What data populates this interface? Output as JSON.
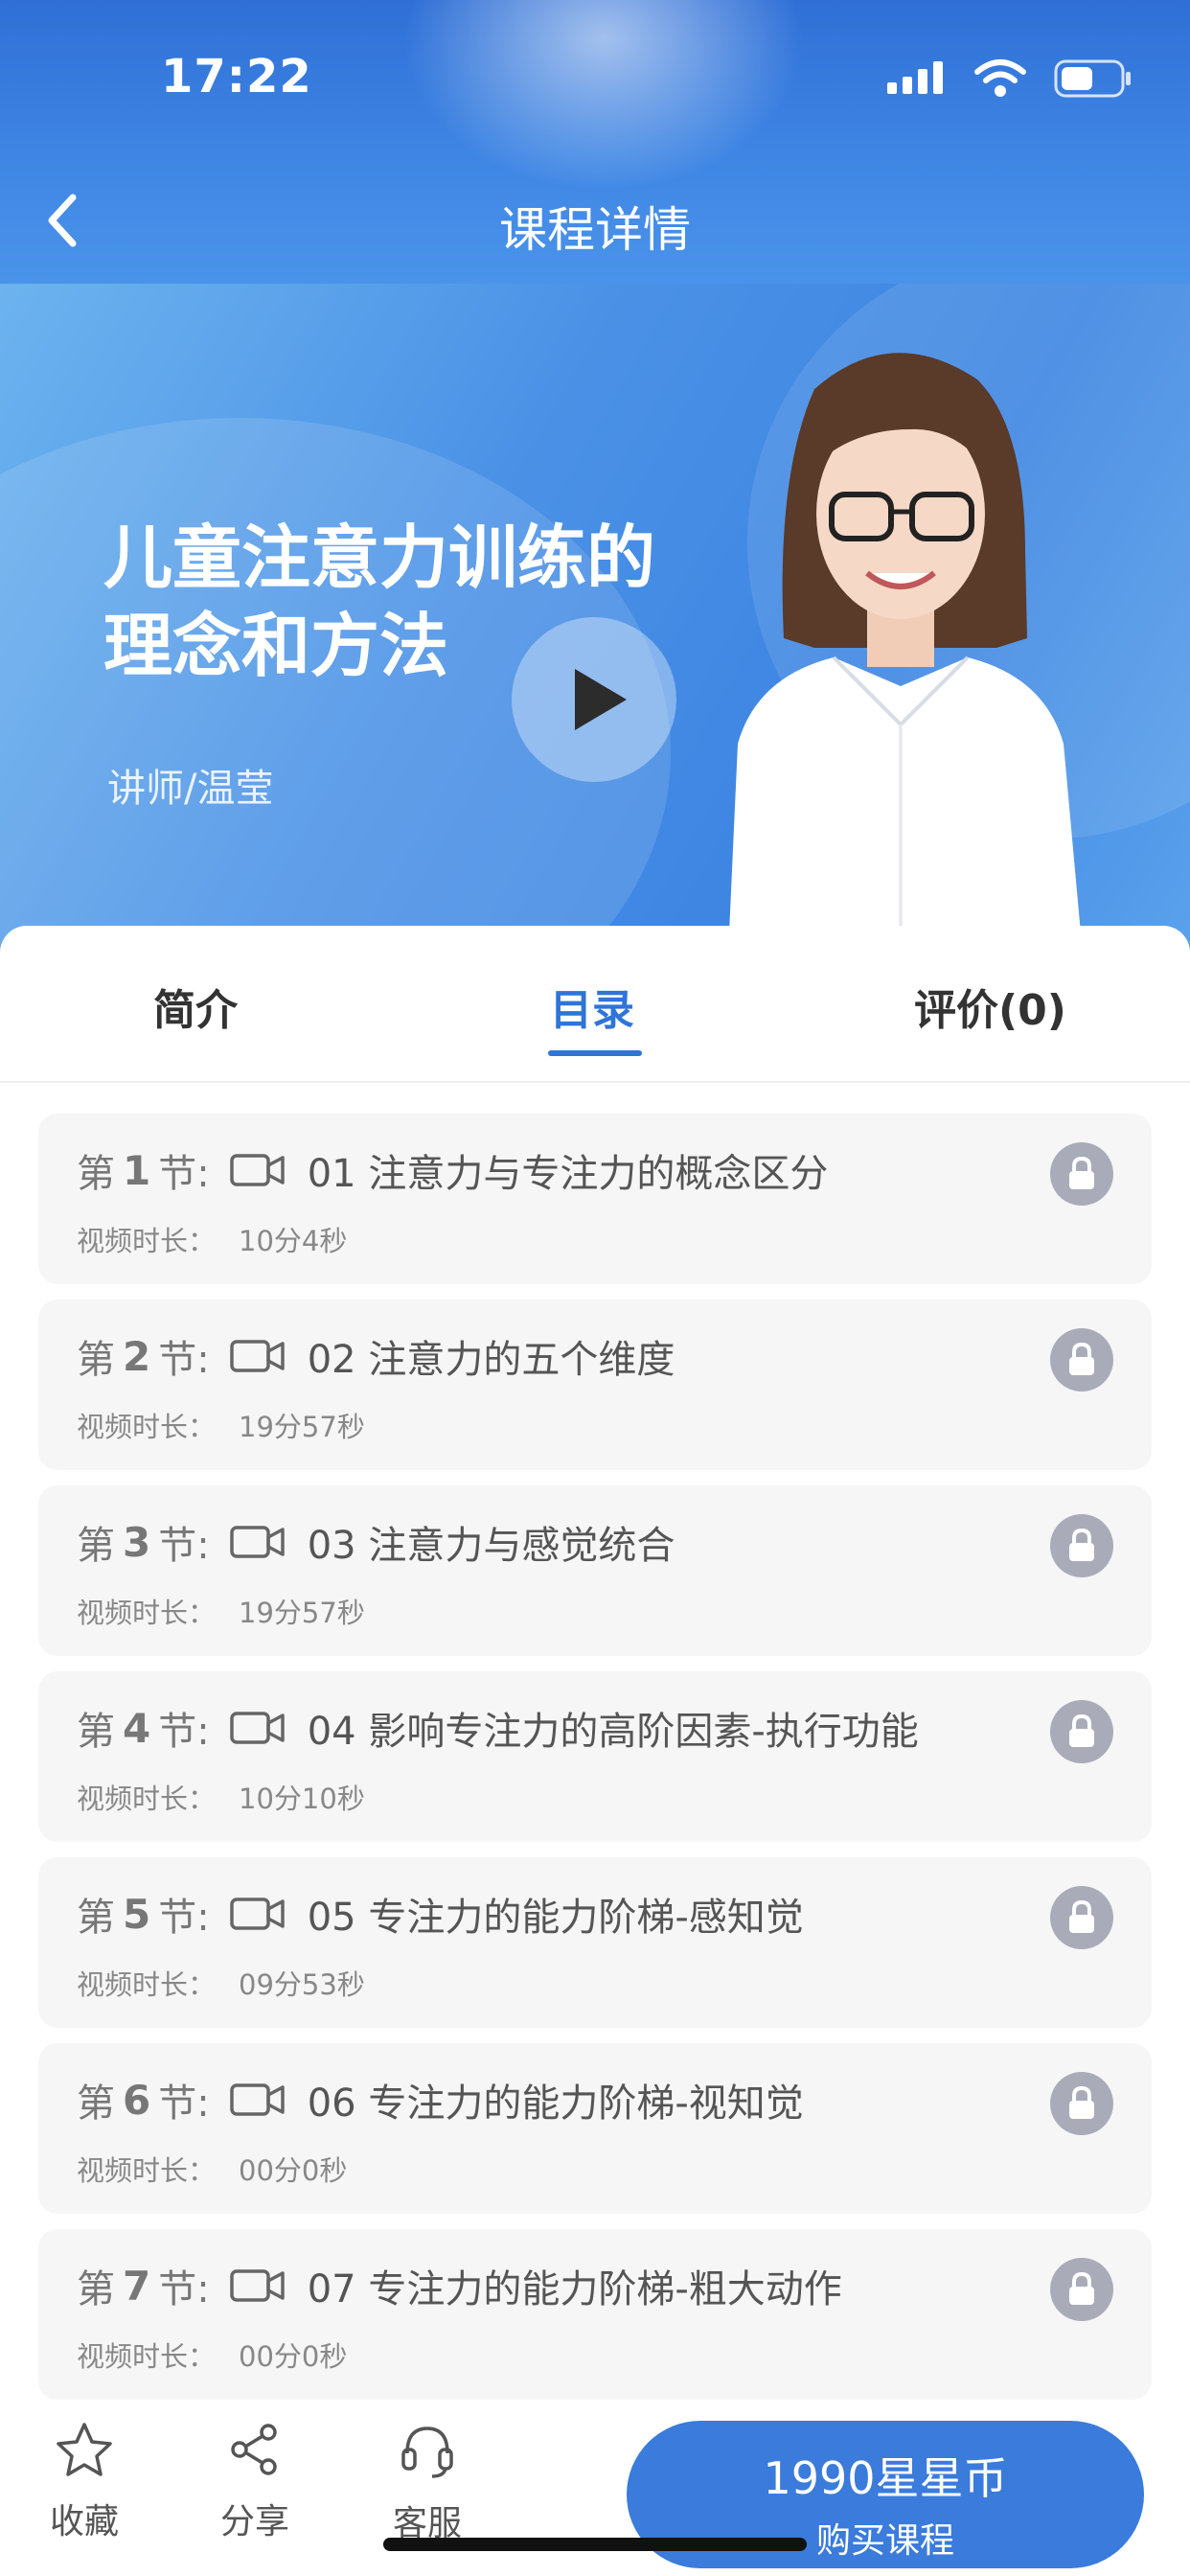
{
  "status_bar": {
    "time": "17:22"
  },
  "nav": {
    "title": "课程详情"
  },
  "banner": {
    "course_title": "儿童注意力训练的理念和方法",
    "teacher": "讲师/温莹"
  },
  "tabs": [
    {
      "label": "简介"
    },
    {
      "label": "目录"
    },
    {
      "label": "评价(0)"
    }
  ],
  "active_tab": "目录",
  "lessons": {
    "section_prefix": "第",
    "section_suffix": "节:",
    "duration_label": "视频时长：",
    "items": [
      {
        "num": "1",
        "title": "01 注意力与专注力的概念区分",
        "duration": "10分4秒"
      },
      {
        "num": "2",
        "title": "02 注意力的五个维度",
        "duration": "19分57秒"
      },
      {
        "num": "3",
        "title": "03 注意力与感觉统合",
        "duration": "19分57秒"
      },
      {
        "num": "4",
        "title": "04 影响专注力的高阶因素-执行功能",
        "duration": "10分10秒"
      },
      {
        "num": "5",
        "title": "05 专注力的能力阶梯-感知觉",
        "duration": "09分53秒"
      },
      {
        "num": "6",
        "title": "06 专注力的能力阶梯-视知觉",
        "duration": "00分0秒"
      },
      {
        "num": "7",
        "title": "07 专注力的能力阶梯-粗大动作",
        "duration": "00分0秒"
      }
    ]
  },
  "bottom_bar": {
    "favorite": "收藏",
    "share": "分享",
    "service": "客服",
    "price": "1990星星币",
    "buy": "购买课程"
  },
  "colors": {
    "accent": "#2f74d8",
    "header": "#3f86e4",
    "lock": "#a9acb8"
  }
}
